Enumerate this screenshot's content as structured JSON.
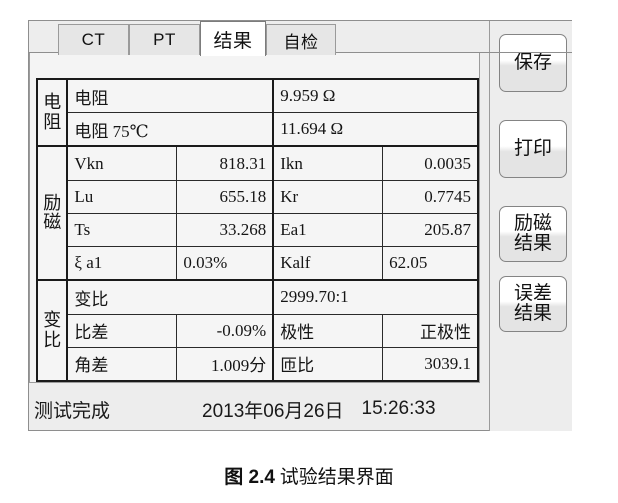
{
  "tabs": [
    {
      "label": "CT",
      "active": false
    },
    {
      "label": "PT",
      "active": false
    },
    {
      "label": "结果",
      "active": true
    },
    {
      "label": "自检",
      "active": false
    }
  ],
  "table": {
    "sections": [
      {
        "group": "电阻",
        "group_chars": [
          "电",
          "阻"
        ],
        "rows": [
          {
            "key1": "电阻",
            "val1": "",
            "key2": "9.959 Ω",
            "val2": "",
            "wide": true
          },
          {
            "key1": "电阻  75℃",
            "val1": "",
            "key2": "11.694 Ω",
            "val2": "",
            "wide": true
          }
        ]
      },
      {
        "group": "励磁",
        "group_chars": [
          "励",
          "磁"
        ],
        "rows": [
          {
            "key1": "Vkn",
            "val1": "818.31",
            "key2": "Ikn",
            "val2": "0.0035",
            "wide": false
          },
          {
            "key1": "Lu",
            "val1": "655.18",
            "key2": "Kr",
            "val2": "0.7745",
            "wide": false
          },
          {
            "key1": "Ts",
            "val1": "33.268",
            "key2": "Ea1",
            "val2": "205.87",
            "wide": false
          },
          {
            "key1": "ξ a1",
            "val1": "0.03%",
            "key2": "Kalf",
            "val2": "62.05",
            "wide": false
          }
        ]
      },
      {
        "group": "变比",
        "group_chars": [
          "变",
          "比"
        ],
        "rows": [
          {
            "key1": "变比",
            "val1": "",
            "key2": "2999.70:1",
            "val2": "",
            "wide": true
          },
          {
            "key1": "比差",
            "val1": "-0.09%",
            "key2": "极性",
            "val2": "正极性",
            "wide": false
          },
          {
            "key1": "角差",
            "val1": "1.009分",
            "key2": "匝比",
            "val2": "3039.1",
            "wide": false
          }
        ]
      }
    ]
  },
  "statusbar": {
    "status": "测试完成",
    "date": "2013年06月26日",
    "time": "15:26:33"
  },
  "buttons": [
    {
      "lines": [
        "保存"
      ]
    },
    {
      "lines": [
        "打印"
      ]
    },
    {
      "lines": [
        "励磁",
        "结果"
      ]
    },
    {
      "lines": [
        "误差",
        "结果"
      ]
    }
  ],
  "caption": {
    "figure_no": "图 2.4",
    "text": "试验结果界面"
  },
  "colors": {
    "window_bg": "#ededed",
    "panel_bg": "#f4f4f4",
    "table_bg": "#f5f5f5",
    "tab_inactive": "#e6e6e6",
    "tab_active": "#ffffff",
    "border": "#8e8e8e",
    "table_border": "#1a1a1a",
    "text": "#151515"
  }
}
